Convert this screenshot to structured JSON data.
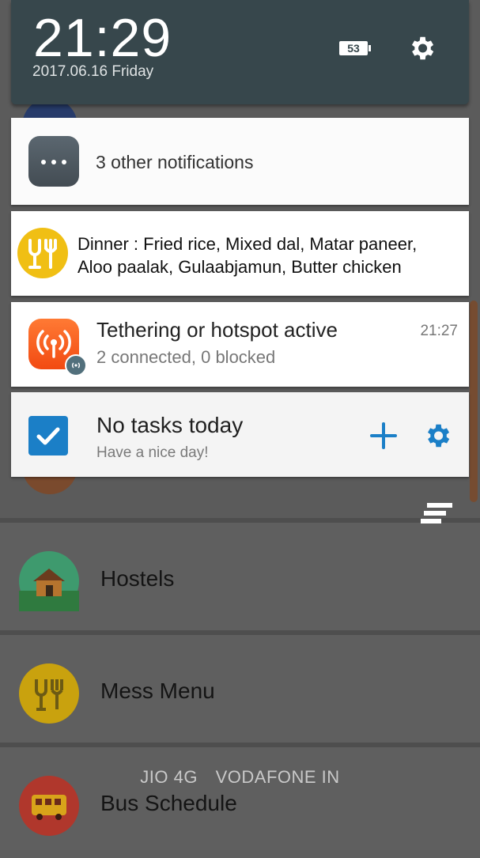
{
  "status": {
    "time": "21:29",
    "date": "2017.06.16 Friday",
    "battery": "53"
  },
  "notifications": {
    "other": {
      "label": "3 other notifications"
    },
    "dinner": {
      "line1": "Dinner : Fried rice, Mixed dal,  Matar paneer,",
      "line2": "Aloo paalak, Gulaabjamun, Butter chicken"
    },
    "hotspot": {
      "title": "Tethering or hotspot active",
      "subtitle": "2 connected, 0 blocked",
      "time": "21:27"
    },
    "tasks": {
      "title": "No tasks today",
      "subtitle": "Have a nice day!"
    }
  },
  "app_list": {
    "items": [
      {
        "label": "Hostels",
        "icon": "house-icon",
        "color": "#3e9a6e"
      },
      {
        "label": "Mess Menu",
        "icon": "fork-glass-icon",
        "color": "#c9a20e"
      },
      {
        "label": "Bus Schedule",
        "icon": "bus-icon",
        "color": "#b0372c"
      }
    ]
  },
  "carriers": [
    "JIO 4G",
    "VODAFONE IN"
  ],
  "colors": {
    "header": "#37474c",
    "accent_blue": "#1b7fc7",
    "hotspot_orange": "#f24a12",
    "dinner_yellow": "#f0bf14"
  }
}
